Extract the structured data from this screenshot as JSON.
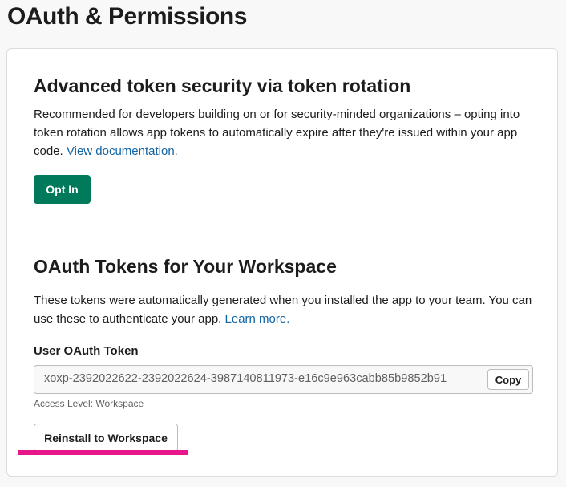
{
  "page_title": "OAuth & Permissions",
  "token_rotation": {
    "title": "Advanced token security via token rotation",
    "description": "Recommended for developers building on or for security-minded organizations – opting into token rotation allows app tokens to automatically expire after they're issued within your app code.",
    "link_text": "View documentation.",
    "button_label": "Opt In"
  },
  "workspace_tokens": {
    "title": "OAuth Tokens for Your Workspace",
    "description": "These tokens were automatically generated when you installed the app to your team. You can use these to authenticate your app.",
    "link_text": "Learn more.",
    "token_label": "User OAuth Token",
    "token_value": "xoxp-2392022622-2392022624-3987140811973-e16c9e963cabb85b9852b91",
    "copy_label": "Copy",
    "access_level": "Access Level: Workspace",
    "reinstall_label": "Reinstall to Workspace"
  },
  "colors": {
    "primary_green": "#007a5a",
    "link_blue": "#1264a3",
    "highlight_magenta": "#e8168b"
  }
}
